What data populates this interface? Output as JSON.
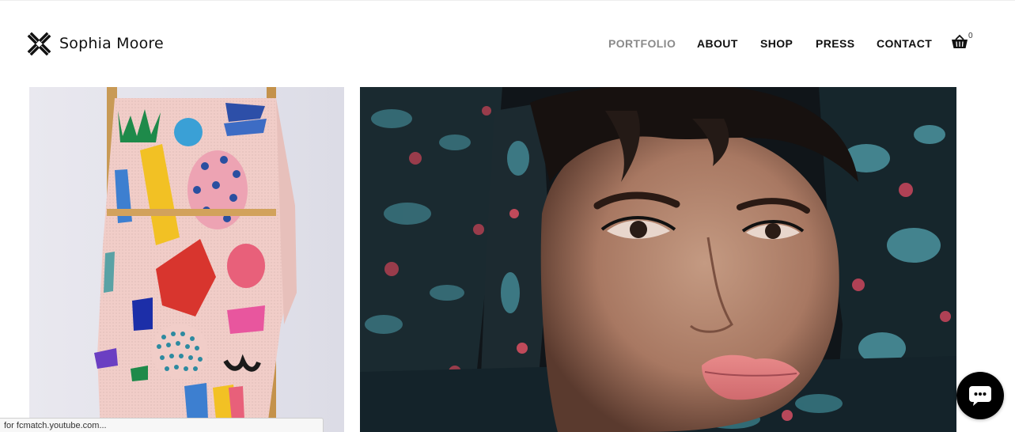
{
  "site": {
    "name": "Sophia Moore"
  },
  "nav": {
    "items": [
      {
        "label": "PORTFOLIO",
        "active": true
      },
      {
        "label": "ABOUT",
        "active": false
      },
      {
        "label": "SHOP",
        "active": false
      },
      {
        "label": "PRESS",
        "active": false
      },
      {
        "label": "CONTACT",
        "active": false
      }
    ],
    "cart_icon": "shopping-basket-icon",
    "cart_count": "0"
  },
  "gallery": {
    "items": [
      {
        "subject": "patterned blanket on wooden ladder"
      },
      {
        "subject": "portrait of woman in floral brocade hood"
      }
    ]
  },
  "status_bar": {
    "text": "for fcmatch.youtube.com..."
  },
  "chat_widget": {
    "icon": "chat-bubble-icon"
  },
  "colors": {
    "accent_active_nav": "#8a8a8a",
    "text": "#111111",
    "chat_bg": "#000000"
  }
}
